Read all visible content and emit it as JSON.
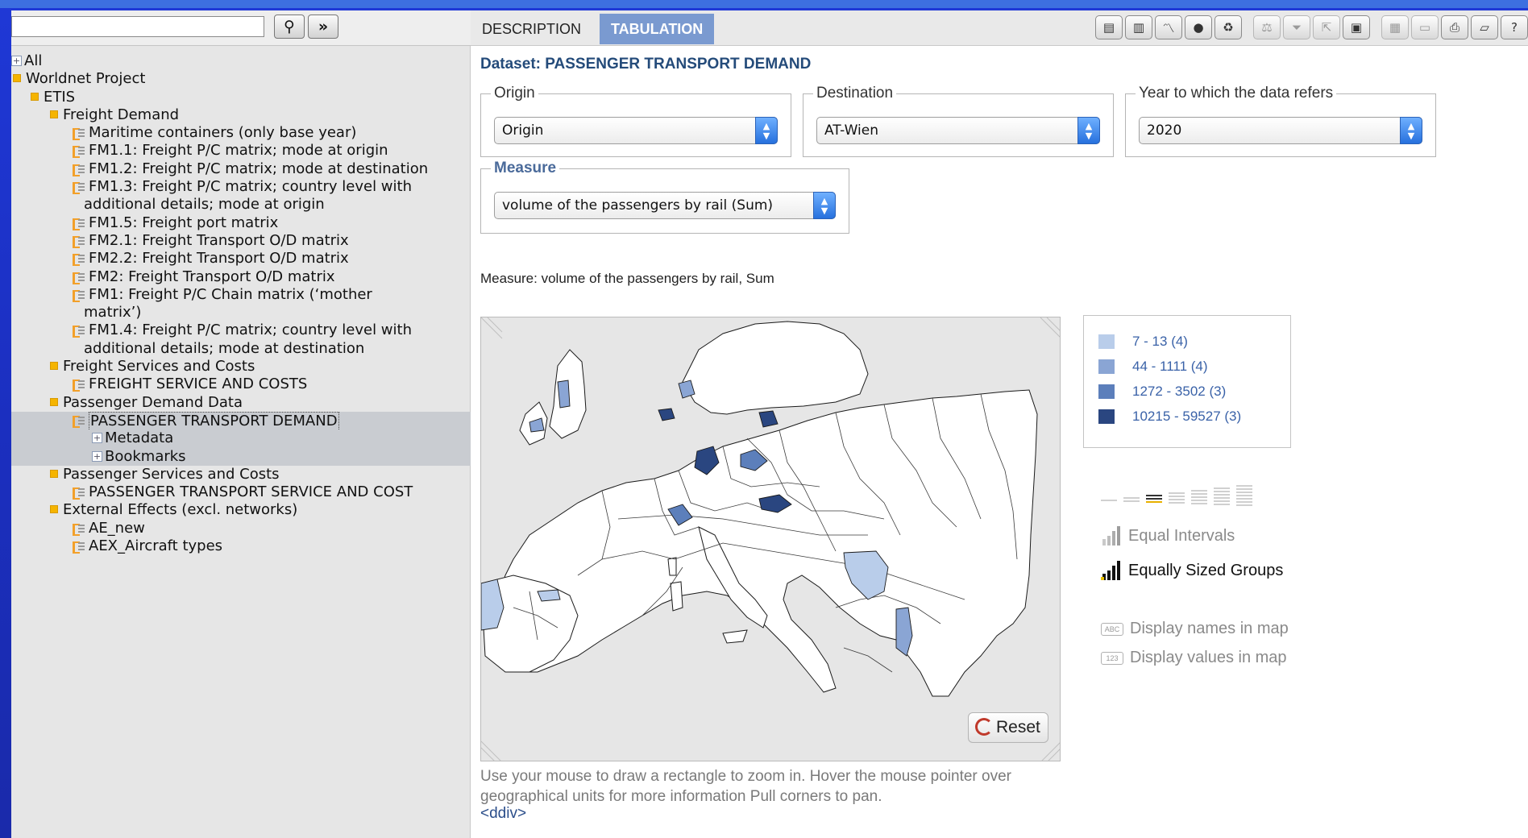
{
  "search": {
    "value": "",
    "find_icon": "binoculars-icon",
    "next_icon": "double-chevron-right-icon"
  },
  "tree": [
    {
      "label": "All",
      "icon": "plus",
      "indent": 0
    },
    {
      "label": "Worldnet Project",
      "icon": "folder",
      "indent": 0
    },
    {
      "label": "ETIS",
      "icon": "folder",
      "indent": 1
    },
    {
      "label": "Freight Demand",
      "icon": "folder",
      "indent": 2
    },
    {
      "label": "Maritime containers (only base year)",
      "icon": "doc",
      "indent": 3
    },
    {
      "label": "FM1.1: Freight P/C matrix; mode at origin",
      "icon": "doc",
      "indent": 3
    },
    {
      "label": "FM1.2: Freight P/C matrix; mode at destination",
      "icon": "doc",
      "indent": 3
    },
    {
      "label": "FM1.3: Freight P/C matrix; country level with",
      "icon": "doc",
      "indent": 3
    },
    {
      "label": "additional details; mode at origin",
      "icon": "none",
      "indent": 3,
      "cont": true
    },
    {
      "label": "FM1.5: Freight port matrix",
      "icon": "doc",
      "indent": 3
    },
    {
      "label": "FM2.1: Freight Transport O/D matrix",
      "icon": "doc",
      "indent": 3
    },
    {
      "label": "FM2.2: Freight Transport O/D matrix",
      "icon": "doc",
      "indent": 3
    },
    {
      "label": "FM2: Freight Transport O/D matrix",
      "icon": "doc",
      "indent": 3
    },
    {
      "label": "FM1: Freight P/C Chain matrix (‘mother",
      "icon": "doc",
      "indent": 3
    },
    {
      "label": "matrix’)",
      "icon": "none",
      "indent": 3,
      "cont": true
    },
    {
      "label": "FM1.4: Freight P/C matrix; country level with",
      "icon": "doc",
      "indent": 3
    },
    {
      "label": "additional details; mode at destination",
      "icon": "none",
      "indent": 3,
      "cont": true
    },
    {
      "label": "Freight Services and Costs",
      "icon": "folder",
      "indent": 2
    },
    {
      "label": "FREIGHT SERVICE AND COSTS",
      "icon": "doc",
      "indent": 3
    },
    {
      "label": "Passenger Demand Data",
      "icon": "folder",
      "indent": 2
    },
    {
      "label": "PASSENGER TRANSPORT DEMAND",
      "icon": "doc",
      "indent": 3,
      "selected": true
    },
    {
      "label": "Metadata",
      "icon": "plus",
      "indent": 4,
      "selected": true
    },
    {
      "label": "Bookmarks",
      "icon": "plus",
      "indent": 4,
      "selected": true
    },
    {
      "label": "Passenger Services and Costs",
      "icon": "folder",
      "indent": 2
    },
    {
      "label": "PASSENGER TRANSPORT SERVICE AND COST",
      "icon": "doc",
      "indent": 3
    },
    {
      "label": "External Effects (excl. networks)",
      "icon": "folder",
      "indent": 2
    },
    {
      "label": "AE_new",
      "icon": "doc",
      "indent": 3
    },
    {
      "label": "AEX_Aircraft types",
      "icon": "doc",
      "indent": 3
    }
  ],
  "tabs": {
    "description": "DESCRIPTION",
    "tabulation": "TABULATION"
  },
  "toolbar": [
    {
      "name": "table-icon",
      "glyph": "▤"
    },
    {
      "name": "bar-chart-icon",
      "glyph": "▥"
    },
    {
      "name": "line-chart-icon",
      "glyph": "〽"
    },
    {
      "name": "globe-icon",
      "glyph": "●"
    },
    {
      "name": "recycle-icon",
      "glyph": "♻"
    },
    {
      "name": "scale-icon",
      "glyph": "⚖",
      "dim": true
    },
    {
      "name": "filter-icon",
      "glyph": "⏷",
      "dim": true
    },
    {
      "name": "export-icon",
      "glyph": "⇱",
      "dim": true
    },
    {
      "name": "save-icon",
      "glyph": "▣"
    },
    {
      "name": "excel-icon",
      "glyph": "▦",
      "dim": true
    },
    {
      "name": "layout-icon",
      "glyph": "▭",
      "dim": true
    },
    {
      "name": "print-icon",
      "glyph": "⎙"
    },
    {
      "name": "folder-icon",
      "glyph": "▱"
    },
    {
      "name": "help-icon",
      "glyph": "?"
    }
  ],
  "dataset_title": "Dataset: PASSENGER TRANSPORT DEMAND",
  "filters": {
    "origin": {
      "legend": "Origin",
      "value": "Origin"
    },
    "destination": {
      "legend": "Destination",
      "value": "AT-Wien"
    },
    "year": {
      "legend": "Year to which the data refers",
      "value": "2020"
    },
    "measure": {
      "legend": "Measure",
      "value": "volume of the passengers by rail (Sum)"
    }
  },
  "measure_caption": "Measure: volume of the passengers by rail, Sum",
  "map": {
    "reset_label": "Reset",
    "hint": "Use your mouse to draw a rectangle to zoom in. Hover the mouse pointer over geographical units for more information Pull corners to pan.",
    "stray_text": "<ddiv>"
  },
  "legend": [
    {
      "label": "7 - 13 (4)",
      "color": "#b9cdea"
    },
    {
      "label": "44 - 1111 (4)",
      "color": "#8aa5d4"
    },
    {
      "label": "1272 - 3502 (3)",
      "color": "#5c7fbb"
    },
    {
      "label": "10215 - 59527 (3)",
      "color": "#2a4680"
    }
  ],
  "classification": {
    "equal_intervals": "Equal Intervals",
    "equally_sized_groups": "Equally Sized Groups",
    "display_names": "Display names in map",
    "display_values": "Display values in map",
    "selected_groups": 3
  }
}
